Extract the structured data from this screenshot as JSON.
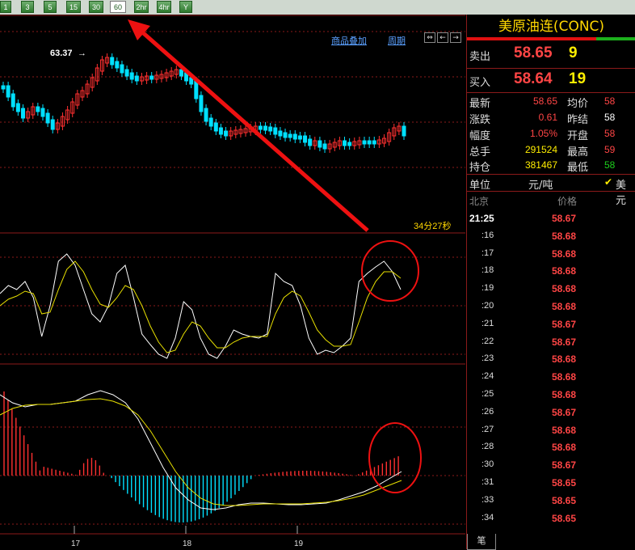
{
  "toolbar": {
    "buttons": [
      "1",
      "3",
      "5",
      "15",
      "30",
      "60",
      "2hr",
      "4hr",
      "Y"
    ],
    "active": "60"
  },
  "chart": {
    "overlay_link": "商品叠加",
    "period_link": "周期",
    "high_label": "63.37",
    "countdown": "34分27秒",
    "date_labels": [
      "17",
      "18",
      "19"
    ]
  },
  "quote": {
    "title": "美原油连(CONC)",
    "sell_label": "卖出",
    "sell_price": "58.65",
    "sell_qty": "9",
    "buy_label": "买入",
    "buy_price": "58.64",
    "buy_qty": "19",
    "stats": {
      "latest_label": "最新",
      "latest": "58.65",
      "change_label": "涨跌",
      "change": "0.61",
      "range_label": "幅度",
      "range": "1.05%",
      "volume_label": "总手",
      "volume": "291524",
      "oi_label": "持仓",
      "oi": "381467",
      "avg_label": "均价",
      "avg": "58",
      "prev_label": "昨结",
      "prev": "58",
      "open_label": "开盘",
      "open": "58",
      "high_label": "最高",
      "high": "59",
      "low_label": "最低",
      "low": "58"
    },
    "unit_label": "单位",
    "unit_value": "元/吨",
    "currency": "美元",
    "city": "北京",
    "price_header": "价格",
    "ticks": [
      {
        "time": "21:25",
        "price": "58.67"
      },
      {
        "time": ":16",
        "price": "58.68"
      },
      {
        "time": ":17",
        "price": "58.68"
      },
      {
        "time": ":18",
        "price": "58.68"
      },
      {
        "time": ":19",
        "price": "58.68"
      },
      {
        "time": ":20",
        "price": "58.68"
      },
      {
        "time": ":21",
        "price": "58.67"
      },
      {
        "time": ":22",
        "price": "58.67"
      },
      {
        "time": ":23",
        "price": "58.68"
      },
      {
        "time": ":24",
        "price": "58.68"
      },
      {
        "time": ":25",
        "price": "58.68"
      },
      {
        "time": ":26",
        "price": "58.67"
      },
      {
        "time": ":27",
        "price": "58.68"
      },
      {
        "time": ":28",
        "price": "58.68"
      },
      {
        "time": ":30",
        "price": "58.67"
      },
      {
        "time": ":31",
        "price": "58.65"
      },
      {
        "time": ":33",
        "price": "58.65"
      },
      {
        "time": ":34",
        "price": "58.65"
      }
    ],
    "bottom_tab": "笔"
  },
  "colors": {
    "up": "#ff3030",
    "down": "#00e0ff",
    "grid": "#8b1a1a",
    "white_line": "#ffffff",
    "yellow_line": "#e8e000",
    "annotation": "#ee1111"
  }
}
